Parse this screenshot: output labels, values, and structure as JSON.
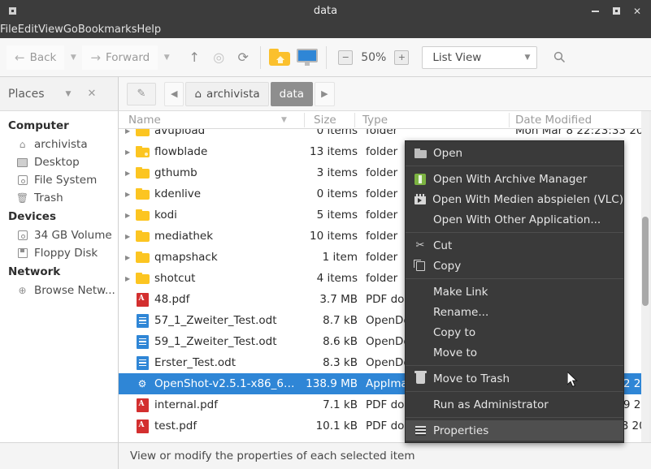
{
  "window": {
    "title": "data",
    "app_icon": "window-icon",
    "controls": {
      "minimize": "–",
      "maximize": "□",
      "close": "✕"
    }
  },
  "menubar": {
    "items": [
      "File",
      "Edit",
      "View",
      "Go",
      "Bookmarks",
      "Help"
    ]
  },
  "toolbar": {
    "back_label": "Back",
    "forward_label": "Forward",
    "up_icon": "arrow-up-icon",
    "stop_icon": "stop-icon",
    "reload_icon": "reload-icon",
    "home_folder_icon": "home-folder-icon",
    "desktop_icon": "monitor-icon",
    "zoom_out": "−",
    "zoom_level": "50%",
    "zoom_in": "+",
    "view_mode": "List View",
    "search_icon": "search-icon"
  },
  "places_panel": {
    "title": "Places",
    "caret_icon": "chevron-down-icon",
    "close_icon": "close-icon"
  },
  "breadcrumb": {
    "edit_icon": "pencil-icon",
    "prev_icon": "◀",
    "next_icon": "▶",
    "items": [
      {
        "label": "archivista",
        "icon": "home-icon",
        "active": false
      },
      {
        "label": "data",
        "icon": "",
        "active": true
      }
    ]
  },
  "sidebar": {
    "sections": [
      {
        "title": "Computer",
        "items": [
          {
            "label": "archivista",
            "icon": "home-icon"
          },
          {
            "label": "Desktop",
            "icon": "desktop-icon"
          },
          {
            "label": "File System",
            "icon": "drive-icon"
          },
          {
            "label": "Trash",
            "icon": "trash-icon"
          }
        ]
      },
      {
        "title": "Devices",
        "items": [
          {
            "label": "34 GB Volume",
            "icon": "drive-icon"
          },
          {
            "label": "Floppy Disk",
            "icon": "floppy-icon"
          }
        ]
      },
      {
        "title": "Network",
        "items": [
          {
            "label": "Browse Netw...",
            "icon": "network-icon"
          }
        ]
      }
    ]
  },
  "file_list": {
    "columns": [
      "Name",
      "Size",
      "Type",
      "Date Modified"
    ],
    "sort_icon": "sort-descending-icon",
    "rows": [
      {
        "name": "avupload",
        "size": "0 items",
        "type": "folder",
        "date": "Mon Mar  8 22:23:33 20",
        "icon": "folder-icon",
        "expander": true,
        "selected": false,
        "clipped_top": true
      },
      {
        "name": "flowblade",
        "size": "13 items",
        "type": "folder",
        "date": "20",
        "icon": "folder-icon",
        "expander": true,
        "selected": false
      },
      {
        "name": "gthumb",
        "size": "3 items",
        "type": "folder",
        "date": "20",
        "icon": "folder-icon",
        "expander": true,
        "selected": false
      },
      {
        "name": "kdenlive",
        "size": "0 items",
        "type": "folder",
        "date": "202",
        "icon": "folder-icon",
        "expander": true,
        "selected": false
      },
      {
        "name": "kodi",
        "size": "5 items",
        "type": "folder",
        "date": "201",
        "icon": "folder-icon",
        "expander": true,
        "selected": false
      },
      {
        "name": "mediathek",
        "size": "10 items",
        "type": "folder",
        "date": "20",
        "icon": "folder-icon",
        "expander": true,
        "selected": false
      },
      {
        "name": "qmapshack",
        "size": "1 item",
        "type": "folder",
        "date": "20",
        "icon": "folder-icon",
        "expander": true,
        "selected": false
      },
      {
        "name": "shotcut",
        "size": "4 items",
        "type": "folder",
        "date": "20",
        "icon": "folder-icon",
        "expander": true,
        "selected": false
      },
      {
        "name": "48.pdf",
        "size": "3.7 MB",
        "type": "PDF docu",
        "date": "20",
        "icon": "pdf-icon",
        "expander": false,
        "selected": false
      },
      {
        "name": "57_1_Zweiter_Test.odt",
        "size": "8.7 kB",
        "type": "OpenDoc",
        "date": "20",
        "icon": "odt-icon",
        "expander": false,
        "selected": false
      },
      {
        "name": "59_1_Zweiter_Test.odt",
        "size": "8.6 kB",
        "type": "OpenDoc",
        "date": "20",
        "icon": "odt-icon",
        "expander": false,
        "selected": false
      },
      {
        "name": "Erster_Test.odt",
        "size": "8.3 kB",
        "type": "OpenDoc",
        "date": "20",
        "icon": "odt-icon",
        "expander": false,
        "selected": false
      },
      {
        "name": "OpenShot-v2.5.1-x86_6…",
        "size": "138.9 MB",
        "type": "AppImage application bundle",
        "date": "Thu Mar 11 19:15:32 20",
        "icon": "gear-icon",
        "expander": false,
        "selected": true
      },
      {
        "name": "internal.pdf",
        "size": "7.1 kB",
        "type": "PDF document",
        "date": "Thu Mar 11 15:43:39 20",
        "icon": "pdf-icon",
        "expander": false,
        "selected": false
      },
      {
        "name": "test.pdf",
        "size": "10.1 kB",
        "type": "PDF document",
        "date": "Tue Mar 16 00:18:28 20",
        "icon": "pdf-icon",
        "expander": false,
        "selected": false
      }
    ]
  },
  "context_menu": {
    "groups": [
      [
        {
          "label": "Open",
          "icon": "folder-icon",
          "highlighted": false
        }
      ],
      [
        {
          "label": "Open With Archive Manager",
          "icon": "archive-manager-icon",
          "highlighted": false
        },
        {
          "label": "Open With Medien abspielen (VLC)",
          "icon": "vlc-icon",
          "highlighted": false
        },
        {
          "label": "Open With Other Application...",
          "icon": "",
          "highlighted": false
        }
      ],
      [
        {
          "label": "Cut",
          "icon": "cut-icon",
          "highlighted": false
        },
        {
          "label": "Copy",
          "icon": "copy-icon",
          "highlighted": false
        }
      ],
      [
        {
          "label": "Make Link",
          "icon": "",
          "highlighted": false
        },
        {
          "label": "Rename...",
          "icon": "",
          "highlighted": false
        },
        {
          "label": "Copy to",
          "icon": "",
          "highlighted": false
        },
        {
          "label": "Move to",
          "icon": "",
          "highlighted": false
        }
      ],
      [
        {
          "label": "Move to Trash",
          "icon": "trash-icon",
          "highlighted": false
        }
      ],
      [
        {
          "label": "Run as Administrator",
          "icon": "",
          "highlighted": false
        }
      ],
      [
        {
          "label": "Properties",
          "icon": "properties-icon",
          "highlighted": true
        }
      ]
    ]
  },
  "statusbar": {
    "text": "View or modify the properties of each selected item"
  },
  "colors": {
    "titlebar_bg": "#3c3c3c",
    "selection_blue": "#2f86d6",
    "context_menu_bg": "#3a3a3a",
    "context_menu_highlight": "#4f4f4f",
    "folder_yellow": "#fcc521",
    "pdf_red": "#d32f2f"
  }
}
